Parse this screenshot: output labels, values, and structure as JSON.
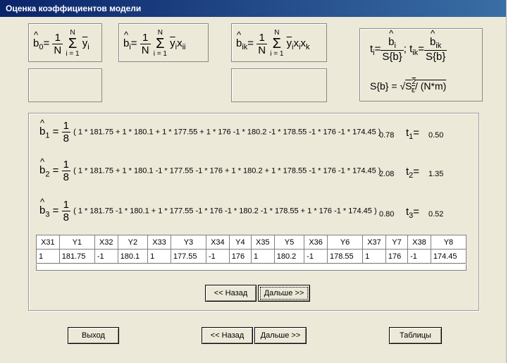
{
  "window": {
    "title": "Оценка коэффициентов модели"
  },
  "formulas": {
    "b0": {
      "lhs": "b",
      "lhs_sub": "0",
      "eq": "=",
      "num": "1",
      "den": "N",
      "sum_top": "N",
      "sum_bot": "i = 1",
      "term": "y",
      "term_sub": "i"
    },
    "bi": {
      "lhs": "b",
      "lhs_sub": "i",
      "eq": "=",
      "num": "1",
      "den": "N",
      "sum_top": "N",
      "sum_bot": "i = 1",
      "term": "y",
      "term_sub": "i",
      "term2": "x",
      "term2_sub": "ii"
    },
    "bik": {
      "lhs": "b",
      "lhs_sub": "ik",
      "eq": "=",
      "num": "1",
      "den": "N",
      "sum_top": "N",
      "sum_bot": "i = 1",
      "term": "y",
      "term_sub": "i",
      "term2": "x",
      "term2_sub": "i",
      "term3": "x",
      "term3_sub": "k"
    },
    "t": {
      "ti": "t",
      "ti_sub": "i",
      "bi": "b",
      "bi_sub": "i",
      "sb": "S{b}",
      "sep": ";",
      "tik": "t",
      "tik_sub": "ik",
      "bik": "b",
      "bik_sub": "ik"
    },
    "sb": {
      "lhs": "S{b} = ",
      "root": "S",
      "root_sup": "2",
      "root_sub": "ε",
      "tail": "/ (N*m)"
    }
  },
  "equations": [
    {
      "lhs": "b",
      "lhs_sub": "1",
      "num": "1",
      "den": "8",
      "expr": "( 1 * 181.75 + 1 * 180.1 + 1 * 177.55 + 1 * 176  -1 * 180.2  -1 * 178.55  -1 * 176  -1 * 174.45 )",
      "value": "0.78",
      "t": "t",
      "t_sub": "1",
      "t_eq": "=",
      "t_value": "0.50"
    },
    {
      "lhs": "b",
      "lhs_sub": "2",
      "num": "1",
      "den": "8",
      "expr": "( 1 * 181.75 + 1 * 180.1  -1 * 177.55  -1 * 176 + 1 * 180.2 + 1 * 178.55  -1 * 176  -1 * 174.45 )",
      "value": "2.08",
      "t": "t",
      "t_sub": "2",
      "t_eq": "=",
      "t_value": "1.35"
    },
    {
      "lhs": "b",
      "lhs_sub": "3",
      "num": "1",
      "den": "8",
      "expr": "( 1 * 181.75  -1 * 180.1 + 1 * 177.55  -1 * 176  -1 * 180.2  -1 * 178.55 + 1 * 176  -1 * 174.45 )",
      "value": "0.80",
      "t": "t",
      "t_sub": "3",
      "t_eq": "=",
      "t_value": "0.52"
    }
  ],
  "table": {
    "headers": [
      "X31",
      "Y1",
      "X32",
      "Y2",
      "X33",
      "Y3",
      "X34",
      "Y4",
      "X35",
      "Y5",
      "X36",
      "Y6",
      "X37",
      "Y7",
      "X38",
      "Y8"
    ],
    "rows": [
      [
        "1",
        "181.75",
        "-1",
        "180.1",
        "1",
        "177.55",
        "-1",
        "176",
        "1",
        "180.2",
        "-1",
        "178.55",
        "1",
        "176",
        "-1",
        "174.45"
      ]
    ]
  },
  "buttons": {
    "inner_back": "<< Назад",
    "inner_next": "Дальше >>",
    "exit": "Выход",
    "back": "<< Назад",
    "next": "Дальше >>",
    "tables": "Таблицы"
  }
}
